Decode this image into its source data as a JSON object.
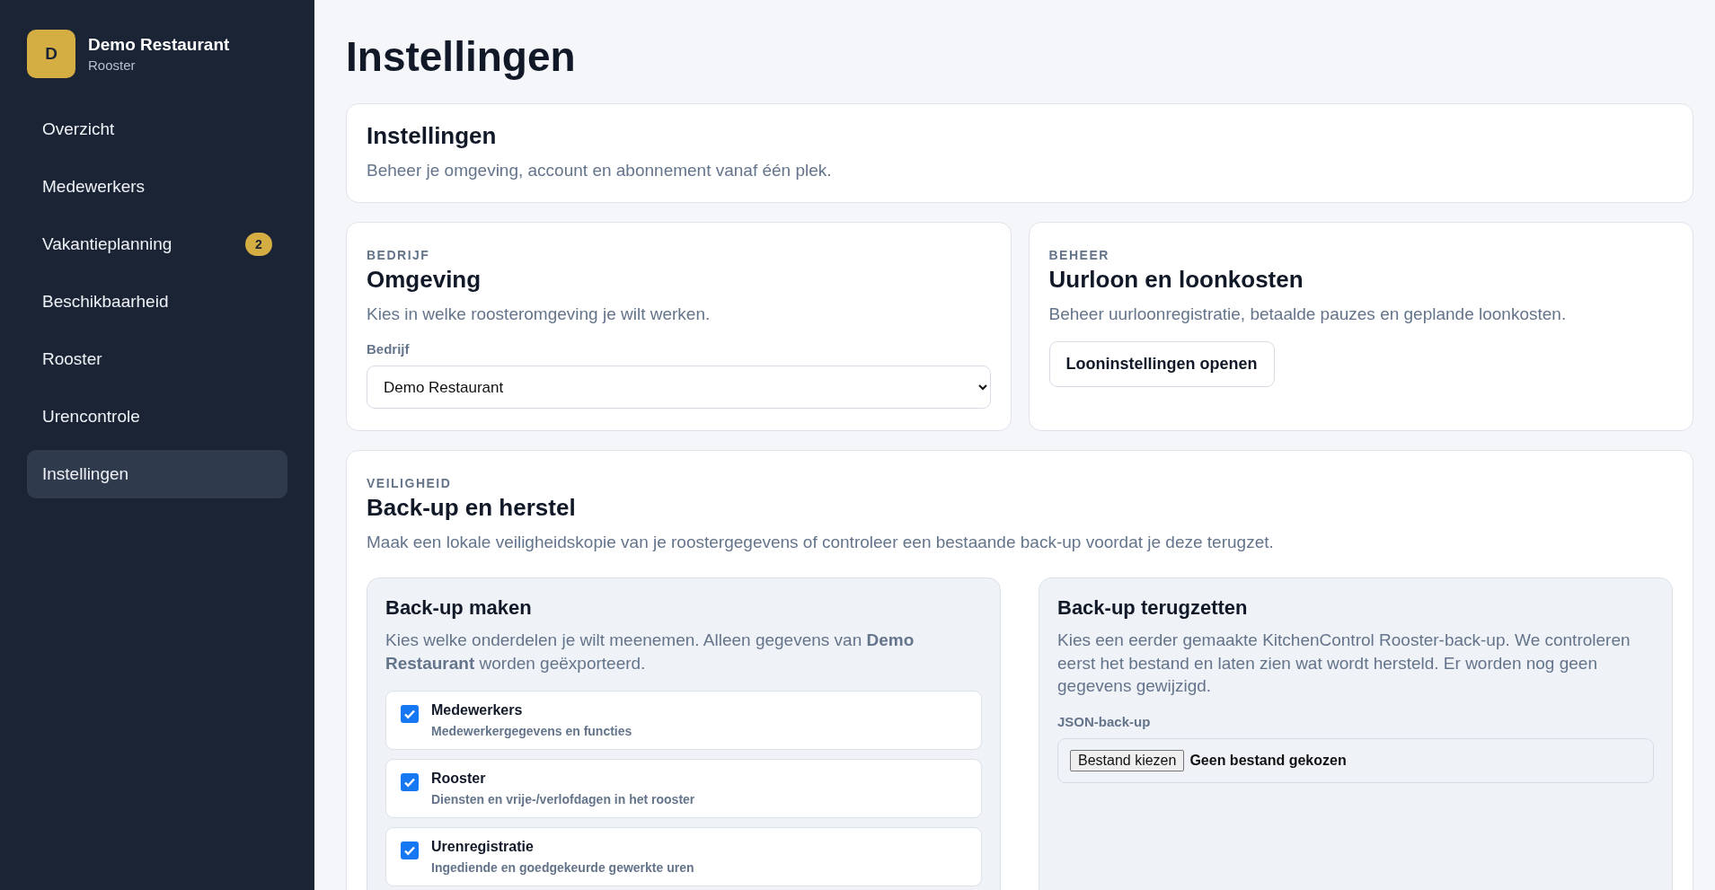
{
  "sidebar": {
    "brand": {
      "initial": "D",
      "name": "Demo Restaurant",
      "subtitle": "Rooster"
    },
    "items": [
      {
        "label": "Overzicht",
        "selected": false
      },
      {
        "label": "Medewerkers",
        "selected": false
      },
      {
        "label": "Vakantieplanning",
        "selected": false,
        "badge": "2"
      },
      {
        "label": "Beschikbaarheid",
        "selected": false
      },
      {
        "label": "Rooster",
        "selected": false
      },
      {
        "label": "Urencontrole",
        "selected": false
      },
      {
        "label": "Instellingen",
        "selected": true
      }
    ]
  },
  "page_title": "Instellingen",
  "intro": {
    "title": "Instellingen",
    "description": "Beheer je omgeving, account en abonnement vanaf één plek."
  },
  "environment": {
    "eyebrow": "BEDRIJF",
    "title": "Omgeving",
    "description": "Kies in welke roosteromgeving je wilt werken.",
    "field_label": "Bedrijf",
    "value": "Demo Restaurant"
  },
  "payroll": {
    "eyebrow": "BEHEER",
    "title": "Uurloon en loonkosten",
    "description": "Beheer uurloonregistratie, betaalde pauzes en geplande loonkosten.",
    "button": "Looninstellingen openen"
  },
  "backup": {
    "eyebrow": "VEILIGHEID",
    "title": "Back-up en herstel",
    "description": "Maak een lokale veiligheidskopie van je roostergegevens of controleer een bestaande back-up voordat je deze terugzet.",
    "create": {
      "title": "Back-up maken",
      "description": "Kies welke onderdelen je wilt meenemen. Alleen gegevens van **Demo Restaurant** worden geëxporteerd.",
      "options": [
        {
          "label": "Medewerkers",
          "detail": "Medewerkergegevens en functies",
          "checked": true
        },
        {
          "label": "Rooster",
          "detail": "Diensten en vrije-/verlofdagen in het rooster",
          "checked": true
        },
        {
          "label": "Urenregistratie",
          "detail": "Ingediende en goedgekeurde gewerkte uren",
          "checked": true
        }
      ]
    },
    "restore": {
      "title": "Back-up terugzetten",
      "description": "Kies een eerder gemaakte KitchenControl Rooster-back-up. We controleren eerst het bestand en laten zien wat wordt hersteld. Er worden nog geen gegevens gewijzigd.",
      "field_label": "JSON-back-up",
      "file_button": "Bestand kiezen",
      "file_status": "Geen bestand gekozen"
    }
  }
}
